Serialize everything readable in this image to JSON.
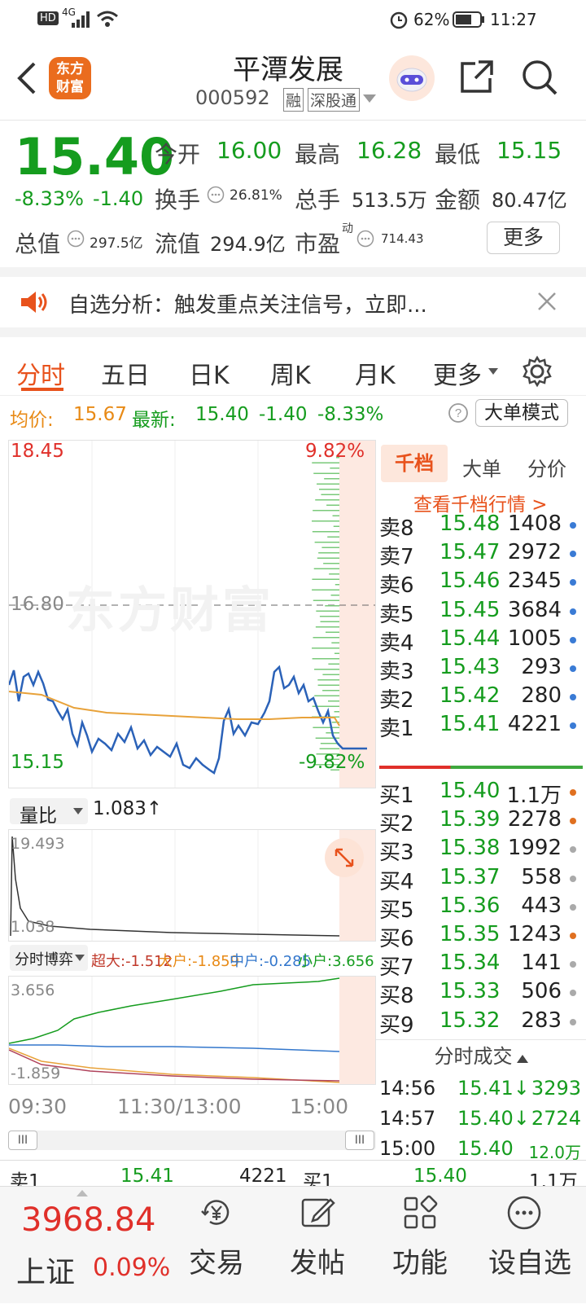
{
  "status": {
    "net": "4G",
    "battery": "62%",
    "time": "11:27",
    "hd": "HD"
  },
  "header": {
    "title": "平潭发展",
    "code": "000592",
    "tag1": "融",
    "tag2": "深股通",
    "logo_line1": "东方",
    "logo_line2": "财富"
  },
  "quote": {
    "price": "15.40",
    "pct": "-8.33%",
    "change": "-1.40",
    "open_label": "今开",
    "open": "16.00",
    "high_label": "最高",
    "high": "16.28",
    "low_label": "最低",
    "low": "15.15",
    "turnover_label": "换手",
    "turnover": "26.81%",
    "vol_label": "总手",
    "vol": "513.5万",
    "amount_label": "金额",
    "amount": "80.47亿",
    "mcap_label": "总值",
    "mcap": "297.5亿",
    "float_label": "流值",
    "float": "294.9亿",
    "pe_label": "市盈",
    "pe_sup": "动",
    "pe": "714.43",
    "more": "更多"
  },
  "notice": {
    "text": "自选分析：触发重点关注信号，立即..."
  },
  "tabs": [
    "分时",
    "五日",
    "日K",
    "周K",
    "月K",
    "更多"
  ],
  "infoline": {
    "avg_label": "均价:",
    "avg": "15.67",
    "latest_label": "最新:",
    "latest": "15.40",
    "chg": "-1.40",
    "pct": "-8.33%",
    "mode": "大单模式"
  },
  "chart": {
    "y_top": "18.45",
    "y_mid": "16.80",
    "y_bot": "15.15",
    "pct_top": "9.82%",
    "pct_bot": "-9.82%",
    "watermark": "东方财富",
    "ratio_label": "量比",
    "ratio": "1.083↑",
    "ratio_top": "19.493",
    "ratio_bot": "1.038",
    "flow_label": "分时博弈",
    "flow_super": "超大:-1.512",
    "flow_big": "大户:-1.859",
    "flow_mid": "中户:-0.285",
    "flow_small": "小户:3.656",
    "flow_top": "3.656",
    "flow_bot": "-1.859",
    "t_start": "09:30",
    "t_mid": "11:30/13:00",
    "t_end": "15:00"
  },
  "orderbook": {
    "tab1": "千档",
    "tab2": "大单",
    "tab3": "分价",
    "link": "查看千档行情 >",
    "asks": [
      {
        "l": "卖8",
        "p": "15.48",
        "v": "1408",
        "c": "#3a7bd5"
      },
      {
        "l": "卖7",
        "p": "15.47",
        "v": "2972",
        "c": "#3a7bd5"
      },
      {
        "l": "卖6",
        "p": "15.46",
        "v": "2345",
        "c": "#3a7bd5"
      },
      {
        "l": "卖5",
        "p": "15.45",
        "v": "3684",
        "c": "#3a7bd5"
      },
      {
        "l": "卖4",
        "p": "15.44",
        "v": "1005",
        "c": "#3a7bd5"
      },
      {
        "l": "卖3",
        "p": "15.43",
        "v": "293",
        "c": "#3a7bd5"
      },
      {
        "l": "卖2",
        "p": "15.42",
        "v": "280",
        "c": "#3a7bd5"
      },
      {
        "l": "卖1",
        "p": "15.41",
        "v": "4221",
        "c": "#3a7bd5"
      }
    ],
    "bids": [
      {
        "l": "买1",
        "p": "15.40",
        "v": "1.1万",
        "c": "#e07020"
      },
      {
        "l": "买2",
        "p": "15.39",
        "v": "2278",
        "c": "#e07020"
      },
      {
        "l": "买3",
        "p": "15.38",
        "v": "1992",
        "c": "#aaaaaa"
      },
      {
        "l": "买4",
        "p": "15.37",
        "v": "558",
        "c": "#aaaaaa"
      },
      {
        "l": "买5",
        "p": "15.36",
        "v": "443",
        "c": "#aaaaaa"
      },
      {
        "l": "买6",
        "p": "15.35",
        "v": "1243",
        "c": "#e07020"
      },
      {
        "l": "买7",
        "p": "15.34",
        "v": "141",
        "c": "#aaaaaa"
      },
      {
        "l": "买8",
        "p": "15.33",
        "v": "506",
        "c": "#aaaaaa"
      },
      {
        "l": "买9",
        "p": "15.32",
        "v": "283",
        "c": "#aaaaaa"
      }
    ],
    "trades_title": "分时成交",
    "trades": [
      {
        "t": "14:56",
        "p": "15.41↓",
        "v": "3293"
      },
      {
        "t": "14:57",
        "p": "15.40↓",
        "v": "2724"
      },
      {
        "t": "15:00",
        "p": "15.40",
        "v": "12.0万"
      }
    ]
  },
  "strip": {
    "ask_label": "卖1",
    "ask_price": "15.41",
    "ask_vol": "4221",
    "bid_label": "买1",
    "bid_price": "15.40",
    "bid_vol": "1.1万"
  },
  "bottom": {
    "index_value": "3968.84",
    "index_name": "上证",
    "index_pct": "0.09%",
    "nav": [
      "交易",
      "发帖",
      "功能",
      "设自选"
    ]
  }
}
